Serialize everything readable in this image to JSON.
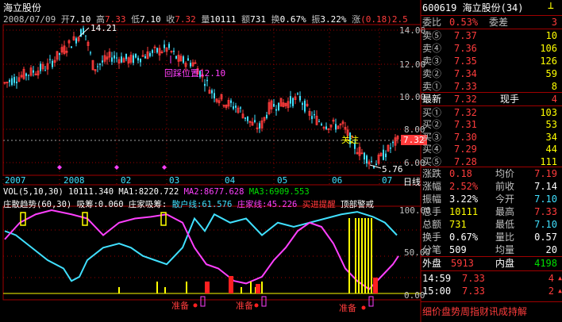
{
  "colors": {
    "up": "#ff3c3c",
    "down": "#40e0ff",
    "grid": "#a00000",
    "yellow": "#ffff00",
    "magenta": "#ff40ff",
    "cyan": "#40e0ff"
  },
  "header": {
    "stock_name": "海立股份",
    "quote": [
      {
        "label": "2008/07/09",
        "value": "",
        "color": "gray"
      },
      {
        "label": "开",
        "value": "7.10",
        "color": "white"
      },
      {
        "label": "高",
        "value": "7.33",
        "color": "red"
      },
      {
        "label": "低",
        "value": "7.10",
        "color": "white"
      },
      {
        "label": "收",
        "value": "7.32",
        "color": "red"
      },
      {
        "label": "量",
        "value": "10111",
        "color": "white"
      },
      {
        "label": "额",
        "value": "731",
        "color": "white"
      },
      {
        "label": "换",
        "value": "0.67%",
        "color": "white"
      },
      {
        "label": "振",
        "value": "3.22%",
        "color": "white"
      },
      {
        "label": "涨",
        "value": "(0.18)2.5",
        "color": "red"
      }
    ]
  },
  "price_chart": {
    "y_ticks": [
      "14.00",
      "12.00",
      "10.00",
      "8.00",
      "6.00"
    ],
    "high_label": "14.21",
    "low_label": "5.76",
    "annotation_retrace": "回踩位置12.10",
    "annotation_watch": "关注",
    "current_price_tag": "7.32"
  },
  "x_axis": {
    "labels": [
      "2007",
      "2008",
      "02",
      "03",
      "04",
      "05",
      "06",
      "07"
    ],
    "right_label": "日线"
  },
  "volume_legend": {
    "vol": "VOL(5,10,30) 10111.340",
    "ma1": "MA1:8220.722",
    "ma2": "MA2:8677.628",
    "ma3": "MA3:6909.553"
  },
  "indicator_legend": {
    "name": "庄散趋势(60,30)",
    "xichou": "吸筹:0.060",
    "zhuangjia_xichou": "庄家吸筹:",
    "sanhu": "散户线:61.576",
    "zhuangjia": "庄家线:45.226",
    "buy_hint": "买进提醒",
    "top_warn": "顶部警戒",
    "y_ticks": [
      "100.00",
      "50.00",
      "0.00"
    ],
    "prepare_label": "准备"
  },
  "panel": {
    "title_code": "600619",
    "title_name": "海立股份",
    "title_num": "(34)",
    "weibi": {
      "label": "委比",
      "value": "0.53%"
    },
    "weicha": {
      "label": "委差",
      "value": "3"
    },
    "sell": [
      {
        "label": "卖⑤",
        "price": "7.37",
        "vol": "10"
      },
      {
        "label": "卖④",
        "price": "7.36",
        "vol": "106"
      },
      {
        "label": "卖③",
        "price": "7.35",
        "vol": "126"
      },
      {
        "label": "卖②",
        "price": "7.34",
        "vol": "59"
      },
      {
        "label": "卖①",
        "price": "7.33",
        "vol": "8"
      }
    ],
    "latest": {
      "label": "最新",
      "price": "7.32",
      "xlabel": "现手",
      "xvalue": "4"
    },
    "buy": [
      {
        "label": "买①",
        "price": "7.32",
        "vol": "103"
      },
      {
        "label": "买②",
        "price": "7.31",
        "vol": "53"
      },
      {
        "label": "买③",
        "price": "7.30",
        "vol": "34"
      },
      {
        "label": "买④",
        "price": "7.29",
        "vol": "44"
      },
      {
        "label": "买⑤",
        "price": "7.28",
        "vol": "111"
      }
    ],
    "stats": [
      {
        "l1": "涨跌",
        "v1": "0.18",
        "c1": "red",
        "l2": "均价",
        "v2": "7.19",
        "c2": "red"
      },
      {
        "l1": "涨幅",
        "v1": "2.52%",
        "c1": "red",
        "l2": "前收",
        "v2": "7.14",
        "c2": "white"
      },
      {
        "l1": "振幅",
        "v1": "3.22%",
        "c1": "white",
        "l2": "今开",
        "v2": "7.10",
        "c2": "cyan"
      },
      {
        "l1": "总手",
        "v1": "10111",
        "c1": "yel",
        "l2": "最高",
        "v2": "7.33",
        "c2": "red"
      },
      {
        "l1": "总额",
        "v1": "731",
        "c1": "yel",
        "l2": "最低",
        "v2": "7.10",
        "c2": "cyan"
      },
      {
        "l1": "换手",
        "v1": "0.67%",
        "c1": "white",
        "l2": "量比",
        "v2": "0.57",
        "c2": "white"
      },
      {
        "l1": "分笔",
        "v1": "509",
        "c1": "white",
        "l2": "均量",
        "v2": "20",
        "c2": "white"
      }
    ],
    "waipan": {
      "label": "外盘",
      "value": "5913"
    },
    "neipan": {
      "label": "内盘",
      "value": "4198"
    },
    "ticks": [
      {
        "time": "14:59",
        "price": "7.33",
        "vol": "4"
      },
      {
        "time": "15:00",
        "price": "7.33",
        "vol": "2"
      }
    ],
    "footer": "细价盘势周指财讯成持解"
  }
}
